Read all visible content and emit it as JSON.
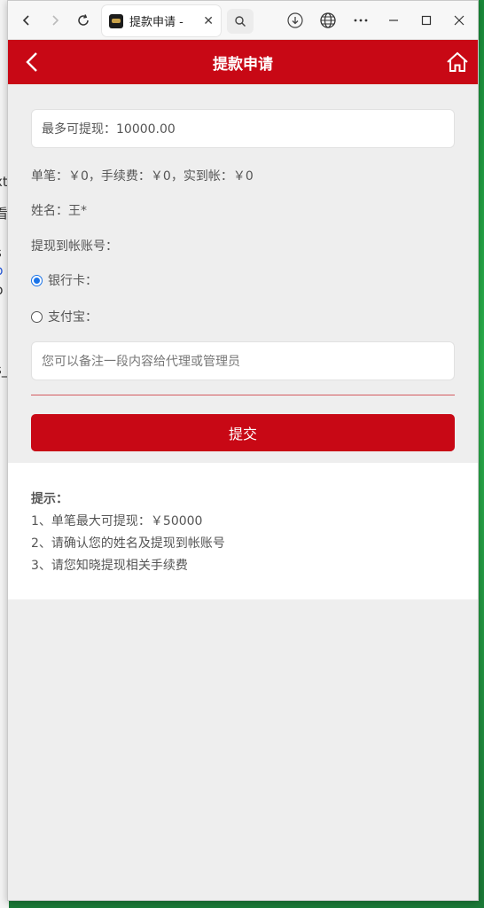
{
  "behind_page": [
    "xt",
    "看",
    "s",
    "p",
    "p",
    "s_"
  ],
  "browser": {
    "tab_title": "提款申请 -",
    "icons": [
      "back-icon",
      "forward-icon",
      "refresh-icon",
      "search-icon",
      "download-icon",
      "globe-icon",
      "more-icon",
      "minimize-icon",
      "maximize-icon",
      "close-icon"
    ]
  },
  "header": {
    "title": "提款申请"
  },
  "form": {
    "max_withdraw": "最多可提现：10000.00",
    "fee_line": "单笔：￥0，手续费：￥0，实到帐：￥0",
    "name_line": "姓名：王*",
    "account_label": "提现到帐账号：",
    "options": [
      {
        "label": "银行卡：",
        "selected": true
      },
      {
        "label": "支付宝：",
        "selected": false
      }
    ],
    "remark_placeholder": "您可以备注一段内容给代理或管理员",
    "submit_label": "提交"
  },
  "tips": {
    "title": "提示：",
    "items": [
      "1、单笔最大可提现：￥50000",
      "2、请确认您的姓名及提现到帐账号",
      "3、请您知晓提现相关手续费"
    ]
  },
  "colors": {
    "accent": "#c80815",
    "radio_selected": "#1a73e8"
  }
}
